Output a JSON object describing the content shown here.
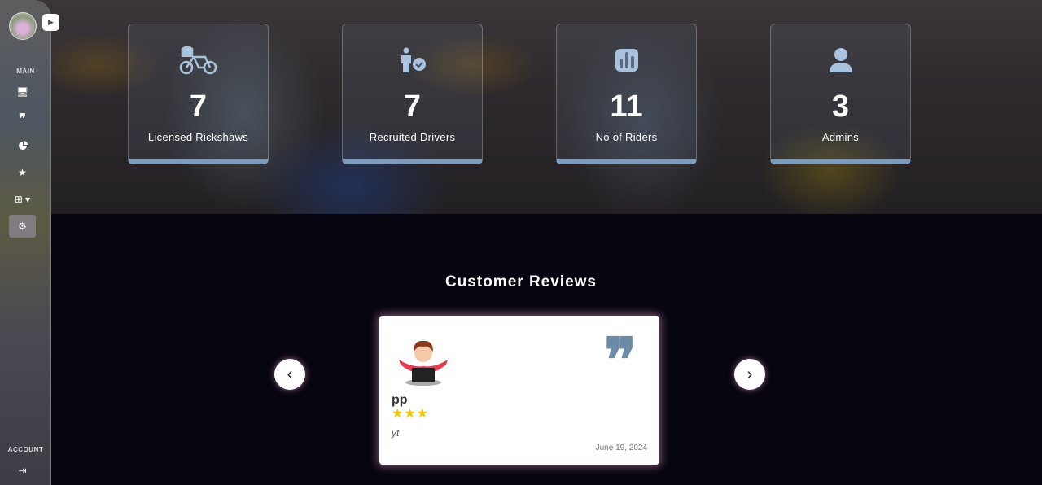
{
  "sidebar": {
    "main_label": "MAIN",
    "account_label": "ACCOUNT"
  },
  "stats": [
    {
      "value": "7",
      "label": "Licensed Rickshaws",
      "icon": "rickshaw-icon"
    },
    {
      "value": "7",
      "label": "Recruited Drivers",
      "icon": "user-check-icon"
    },
    {
      "value": "11",
      "label": "No of Riders",
      "icon": "bar-chart-icon"
    },
    {
      "value": "3",
      "label": "Admins",
      "icon": "user-icon"
    }
  ],
  "reviews": {
    "title": "Customer Reviews",
    "current": {
      "name": "pp",
      "rating": 3,
      "text": "yt",
      "date": "June 19, 2024"
    }
  },
  "colors": {
    "accent": "#7e9bbb",
    "star": "#f5c400",
    "quote": "#6b8aa5"
  }
}
